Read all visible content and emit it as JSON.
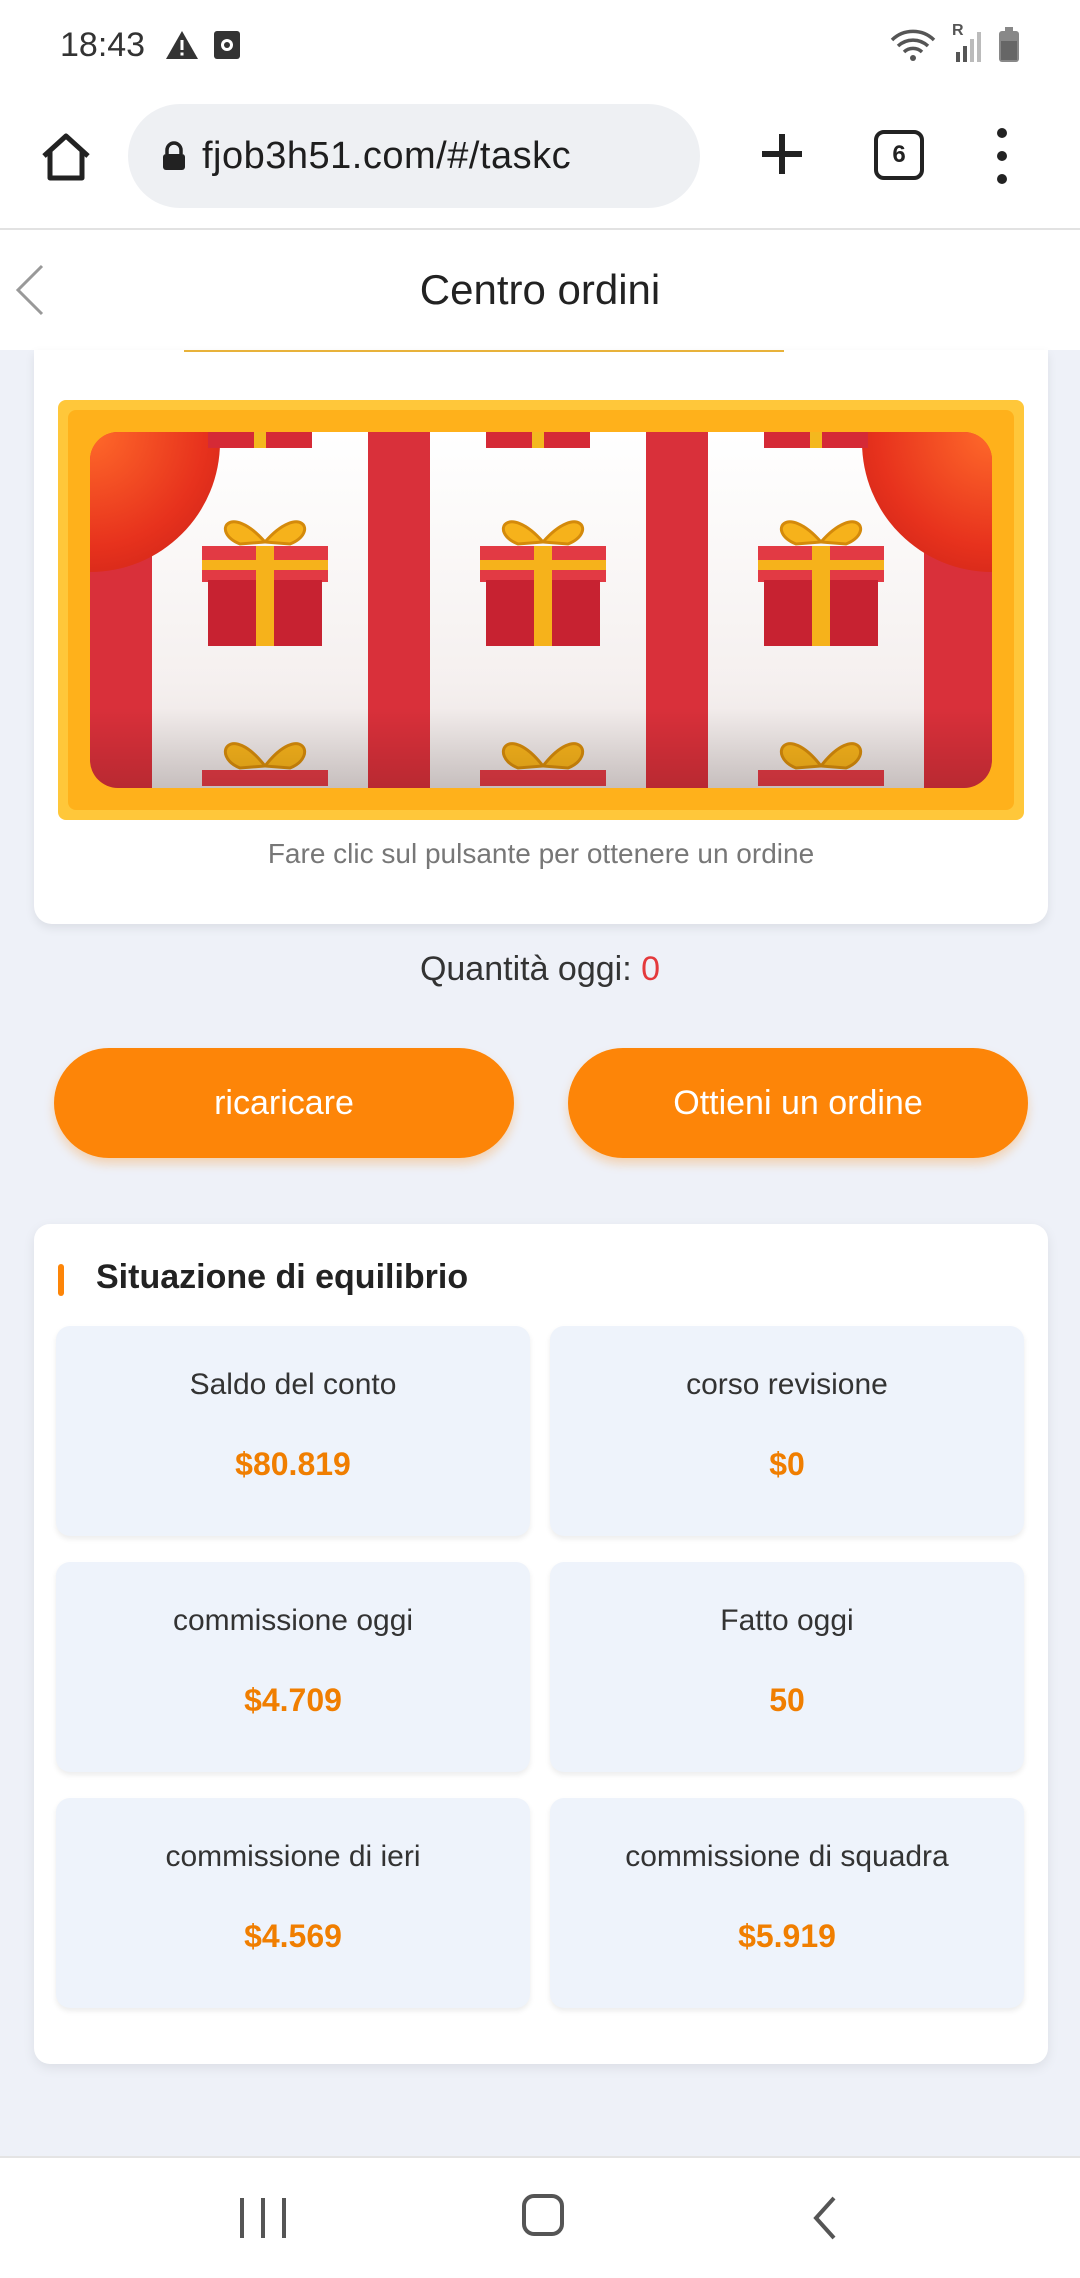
{
  "status_bar": {
    "time": "18:43",
    "icons": [
      "warning-icon",
      "screenshot-icon",
      "wifi-icon",
      "signal-icon",
      "battery-icon"
    ],
    "signal_letter": "R"
  },
  "browser": {
    "url": "fjob3h51.com/#/taskc",
    "tab_count": "6"
  },
  "header": {
    "title": "Centro ordini"
  },
  "slot": {
    "hint": "Fare clic sul pulsante per ottenere un ordine"
  },
  "quantity": {
    "label": "Quantità oggi: ",
    "value": "0"
  },
  "buttons": {
    "recharge": "ricaricare",
    "get_order": "Ottieni un ordine"
  },
  "balance": {
    "title": "Situazione di equilibrio",
    "stats": [
      {
        "label": "Saldo del conto",
        "value": "$80.819"
      },
      {
        "label": "corso revisione",
        "value": "$0"
      },
      {
        "label": "commissione oggi",
        "value": "$4.709"
      },
      {
        "label": "Fatto oggi",
        "value": "50"
      },
      {
        "label": "commissione di ieri",
        "value": "$4.569"
      },
      {
        "label": "commissione di squadra",
        "value": "$5.919"
      }
    ]
  },
  "colors": {
    "accent": "#fd8508",
    "value_orange": "#f07e00",
    "quantity_red": "#e4393c",
    "page_bg": "#eef1f8"
  }
}
